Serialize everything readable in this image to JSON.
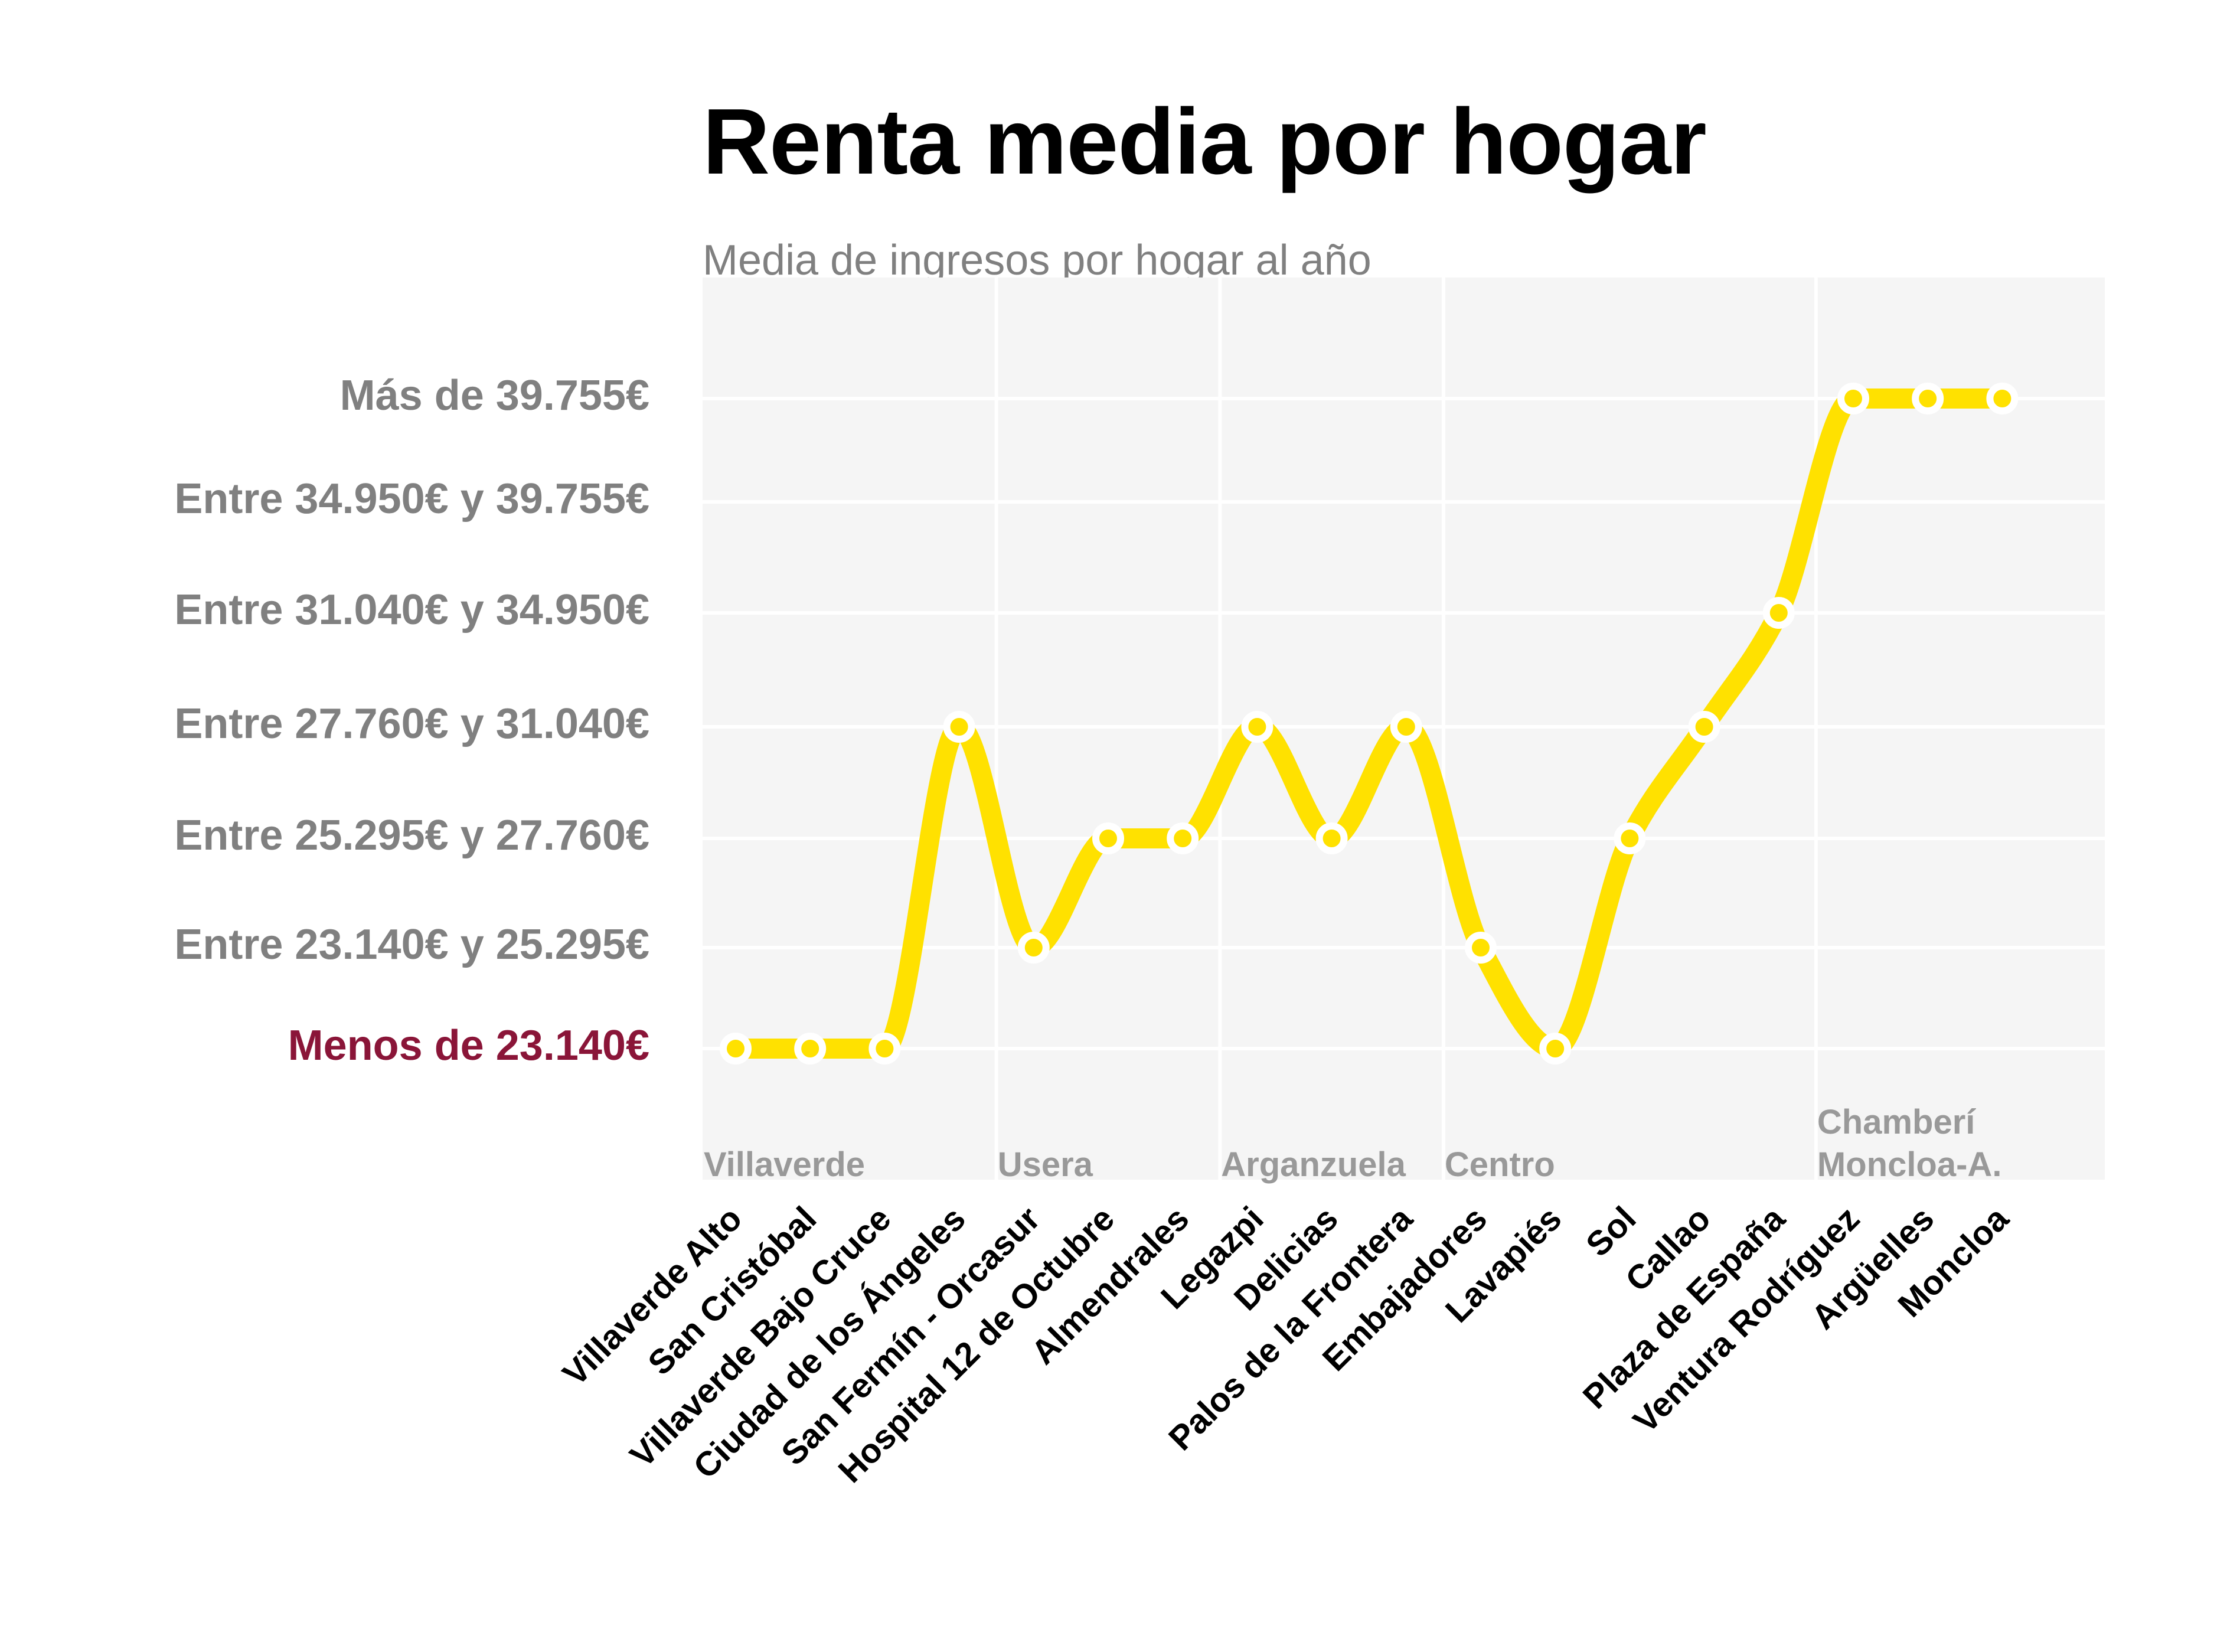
{
  "chart_data": {
    "type": "line",
    "title": "Renta media por hogar",
    "subtitle": "Media de ingresos por hogar al año",
    "xlabel": "",
    "ylabel": "",
    "y_levels": [
      "Menos de 23.140€",
      "Entre 23.140€ y 25.295€",
      "Entre 25.295€ y 27.760€",
      "Entre 27.760€ y 31.040€",
      "Entre 31.040€ y 34.950€",
      "Entre 34.950€ y 39.755€",
      "Más de 39.755€"
    ],
    "ylim": [
      0,
      6
    ],
    "categories": [
      "Villaverde Alto",
      "San Cristóbal",
      "Villaverde Bajo Cruce",
      "Ciudad de los Ángeles",
      "San Fermín - Orcasur",
      "Hospital 12 de Octubre",
      "Almendrales",
      "Legazpi",
      "Delicias",
      "Palos de la Frontera",
      "Embajadores",
      "Lavapiés",
      "Sol",
      "Callao",
      "Plaza de España",
      "Ventura Rodríguez",
      "Argüelles",
      "Moncloa"
    ],
    "series": [
      {
        "values": [
          0,
          0,
          0,
          3,
          1,
          2,
          2,
          3,
          2,
          3,
          1,
          0,
          2,
          3,
          4,
          6,
          6,
          6
        ]
      }
    ],
    "districts": [
      {
        "label": "Villaverde",
        "start_index": 0
      },
      {
        "label": "Usera",
        "start_index": 4
      },
      {
        "label": "Arganzuela",
        "start_index": 7
      },
      {
        "label": "Centro",
        "start_index": 10
      },
      {
        "label": "Chamberí\nMoncloa-A.",
        "start_index": 15
      }
    ],
    "grid": true,
    "legend": "none",
    "colors": {
      "line": "#FFE100",
      "panel": "#F5F5F5",
      "grid": "#FFFFFF",
      "y_label": "#808080",
      "y_label_lowest": "#8A1538",
      "district_label": "#999999",
      "x_label": "#000000",
      "marker_fill": "#FFE100",
      "marker_ring": "#FFFFFF"
    }
  }
}
